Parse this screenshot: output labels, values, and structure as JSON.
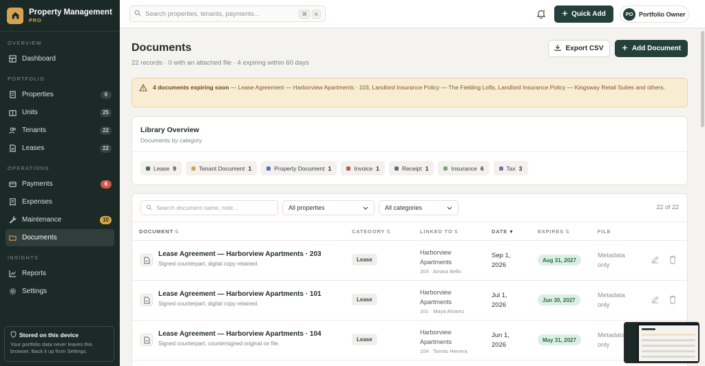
{
  "brand": {
    "title": "Property Management",
    "tier": "PRO"
  },
  "sidebar": {
    "sections": [
      {
        "label": "OVERVIEW",
        "items": [
          {
            "label": "Dashboard",
            "icon": "dashboard-icon"
          }
        ]
      },
      {
        "label": "PORTFOLIO",
        "items": [
          {
            "label": "Properties",
            "icon": "building-icon",
            "badge": "6"
          },
          {
            "label": "Units",
            "icon": "units-icon",
            "badge": "25"
          },
          {
            "label": "Tenants",
            "icon": "users-icon",
            "badge": "22"
          },
          {
            "label": "Leases",
            "icon": "lease-icon",
            "badge": "22"
          }
        ]
      },
      {
        "label": "OPERATIONS",
        "items": [
          {
            "label": "Payments",
            "icon": "payments-icon",
            "badge": "6"
          },
          {
            "label": "Expenses",
            "icon": "receipt-icon"
          },
          {
            "label": "Maintenance",
            "icon": "wrench-icon",
            "badge": "10"
          },
          {
            "label": "Documents",
            "icon": "folder-icon"
          }
        ]
      },
      {
        "label": "INSIGHTS",
        "items": [
          {
            "label": "Reports",
            "icon": "chart-icon"
          },
          {
            "label": "Settings",
            "icon": "gear-icon"
          }
        ]
      }
    ],
    "device": {
      "title": "Stored on this device",
      "text": "Your portfolio data never leaves this browser. Back it up from Settings."
    }
  },
  "topbar": {
    "search_placeholder": "Search properties, tenants, payments...",
    "kbd1": "⌘",
    "kbd2": "K",
    "quick_add": "Quick Add",
    "owner_initials": "PO",
    "owner_name": "Portfolio Owner"
  },
  "page": {
    "title": "Documents",
    "subtitle": "22 records · 0 with an attached file · 4 expiring within 60 days",
    "export": "Export CSV",
    "add": "Add Document"
  },
  "alert": {
    "strong": "4 documents expiring soon",
    "text": " — Lease Agreement — Harborview Apartments · 103, Landlord Insurance Policy — The Fielding Lofts, Landlord Insurance Policy — Kingsway Retail Suites and others."
  },
  "library": {
    "title": "Library Overview",
    "subtitle": "Documents by category",
    "chips": [
      {
        "label": "Lease",
        "count": "9",
        "color": "#3e6b5a"
      },
      {
        "label": "Tenant Document",
        "count": "1",
        "color": "#d4a452"
      },
      {
        "label": "Property Document",
        "count": "1",
        "color": "#4a72c4"
      },
      {
        "label": "Invoice",
        "count": "1",
        "color": "#c25548"
      },
      {
        "label": "Receipt",
        "count": "1",
        "color": "#5c6b76"
      },
      {
        "label": "Insurance",
        "count": "6",
        "color": "#7aa070"
      },
      {
        "label": "Tax",
        "count": "3",
        "color": "#7d6fa3"
      }
    ]
  },
  "table": {
    "search_placeholder": "Search document name, note...",
    "property_filter": "All properties",
    "category_filter": "All categories",
    "count": "22 of 22",
    "headers": {
      "document": "DOCUMENT",
      "category": "CATEGORY",
      "linked": "LINKED TO",
      "date": "DATE",
      "expires": "EXPIRES",
      "file": "FILE"
    },
    "rows": [
      {
        "name": "Lease Agreement — Harborview Apartments · 203",
        "note": "Signed counterpart, digital copy retained.",
        "category": "Lease",
        "linked1": "Harborview",
        "linked2": "Apartments",
        "linked_sub": "203 · Amara Bello",
        "date1": "Sep 1,",
        "date2": "2026",
        "expires": "Aug 31, 2027",
        "file1": "Metadata",
        "file2": "only"
      },
      {
        "name": "Lease Agreement — Harborview Apartments · 101",
        "note": "Signed counterpart, digital copy retained.",
        "category": "Lease",
        "linked1": "Harborview",
        "linked2": "Apartments",
        "linked_sub": "101 · Maya Alvarez",
        "date1": "Jul 1,",
        "date2": "2026",
        "expires": "Jun 30, 2027",
        "file1": "Metadata",
        "file2": "only"
      },
      {
        "name": "Lease Agreement — Harborview Apartments · 104",
        "note": "Signed counterpart, countersigned original on file.",
        "category": "Lease",
        "linked1": "Harborview",
        "linked2": "Apartments",
        "linked_sub": "104 · Tomás Herrera",
        "date1": "Jun 1,",
        "date2": "2026",
        "expires": "May 31, 2027",
        "file1": "Metadata",
        "file2": "only"
      }
    ]
  }
}
